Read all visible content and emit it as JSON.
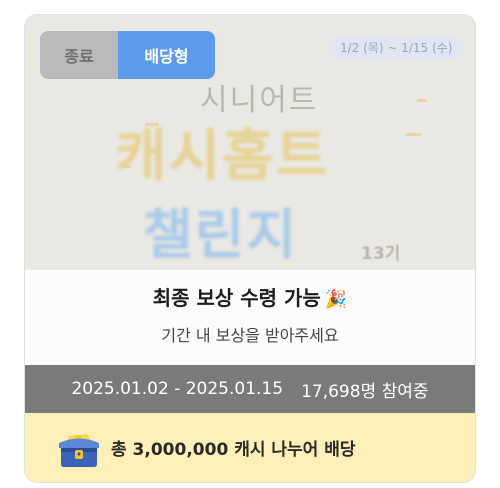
{
  "badges": {
    "status": "종료",
    "type": "배당형"
  },
  "banner": {
    "date_chip": "1/2 (목) ~ 1/15 (수)",
    "art_small": "시니어트",
    "art_title_1": "캐시홈트",
    "art_title_2": "챌린지",
    "art_generation": "13기"
  },
  "sheet": {
    "headline": "최종 보상 수령 가능",
    "headline_icon": "party-popper-icon",
    "subtext": "기간 내 보상을 받아주세요"
  },
  "period": {
    "dates": "2025.01.02 - 2025.01.15",
    "participants": "17,698명 참여중"
  },
  "reward": {
    "icon": "treasure-chest-icon",
    "text": "총 3,000,000 캐시 나누어 배당"
  },
  "colors": {
    "type_badge": "#5b9bea",
    "status_badge": "#b9b9b9",
    "period_bar": "#7a7a78",
    "reward_bar": "#fdefb8"
  }
}
